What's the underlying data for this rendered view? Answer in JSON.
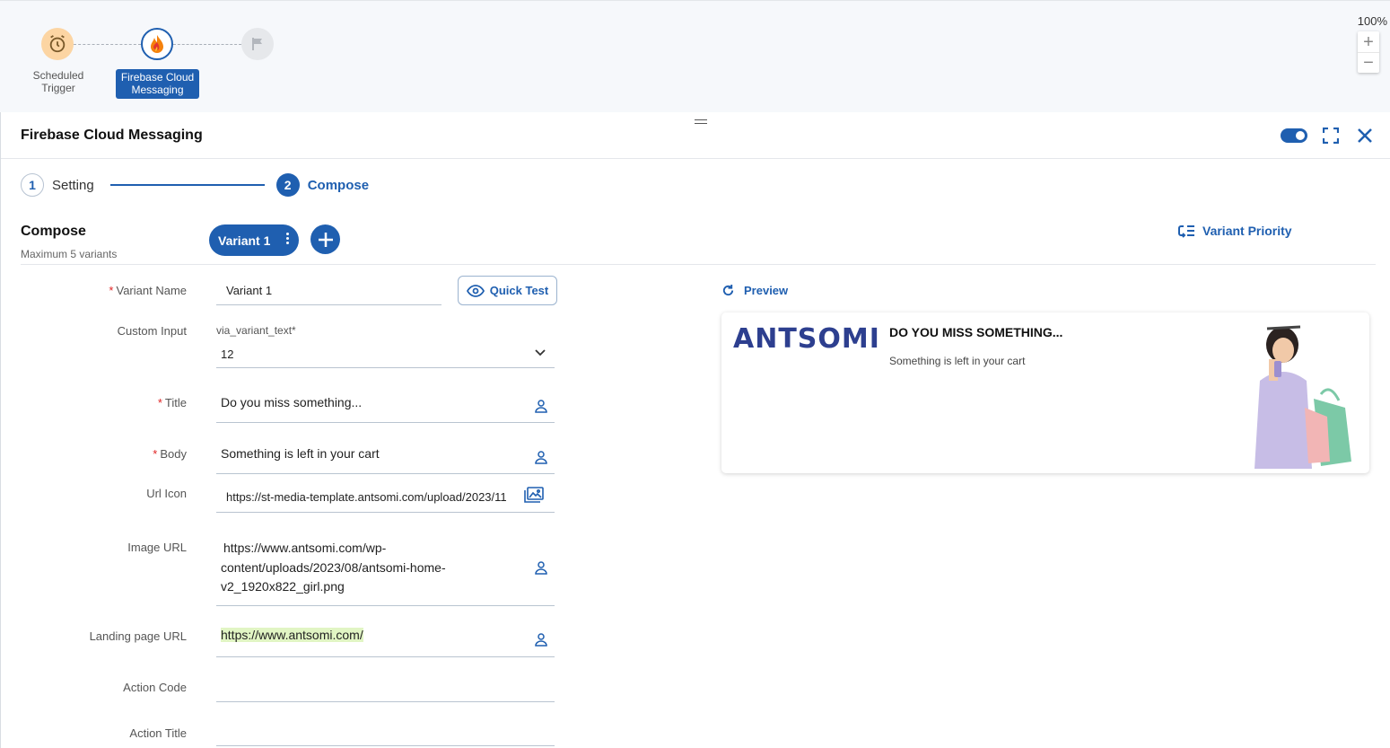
{
  "canvas": {
    "nodes": [
      {
        "label": "Scheduled Trigger"
      },
      {
        "label": "Firebase Cloud Messaging"
      }
    ],
    "zoom_level": "100%",
    "zoom_in": "+",
    "zoom_out": "−"
  },
  "panel": {
    "title": "Firebase Cloud Messaging",
    "steps": [
      {
        "number": "1",
        "label": "Setting"
      },
      {
        "number": "2",
        "label": "Compose"
      }
    ]
  },
  "compose": {
    "title": "Compose",
    "subtitle": "Maximum 5 variants",
    "variant_tab": "Variant 1",
    "variant_priority": "Variant Priority"
  },
  "form": {
    "quick_test": "Quick Test",
    "variant_name": {
      "label": "Variant Name",
      "value": "Variant 1"
    },
    "custom_input": {
      "label": "Custom Input",
      "field_label": "via_variant_text*",
      "value": "12"
    },
    "title": {
      "label": "Title",
      "value": "Do you miss something..."
    },
    "body": {
      "label": "Body",
      "value": "Something is left in your cart"
    },
    "url_icon": {
      "label": "Url Icon",
      "value": "https://st-media-template.antsomi.com/upload/2023/11"
    },
    "image_url": {
      "label": "Image URL",
      "value": "https://www.antsomi.com/wp-content/uploads/2023/08/antsomi-home-v2_1920x822_girl.png",
      "lines": [
        "https://www.antsomi.com/wp-",
        "content/uploads/2023/08/antsomi-home-",
        "v2_1920x822_girl.png"
      ]
    },
    "landing_page_url": {
      "label": "Landing page URL",
      "value": "https://www.antsomi.com/"
    },
    "action_code": {
      "label": "Action Code",
      "value": ""
    },
    "action_title": {
      "label": "Action Title",
      "value": ""
    }
  },
  "preview": {
    "label": "Preview",
    "logo_text": "ANTSOMI",
    "title": "DO YOU MISS SOMETHING...",
    "body": "Something is left in your cart"
  },
  "colors": {
    "accent": "#1f5fb0",
    "required": "#e02424",
    "trigger_node": "#fcd5a3",
    "link_highlight": "#e1f5c4"
  },
  "icons": [
    "alarm-clock-icon",
    "firebase-flame-icon",
    "flag-icon",
    "toggle-icon",
    "fullscreen-icon",
    "close-icon",
    "plus-icon",
    "kebab-menu-icon",
    "variant-priority-icon",
    "eye-icon",
    "refresh-icon",
    "chevron-down-icon",
    "person-icon",
    "image-gallery-icon"
  ]
}
